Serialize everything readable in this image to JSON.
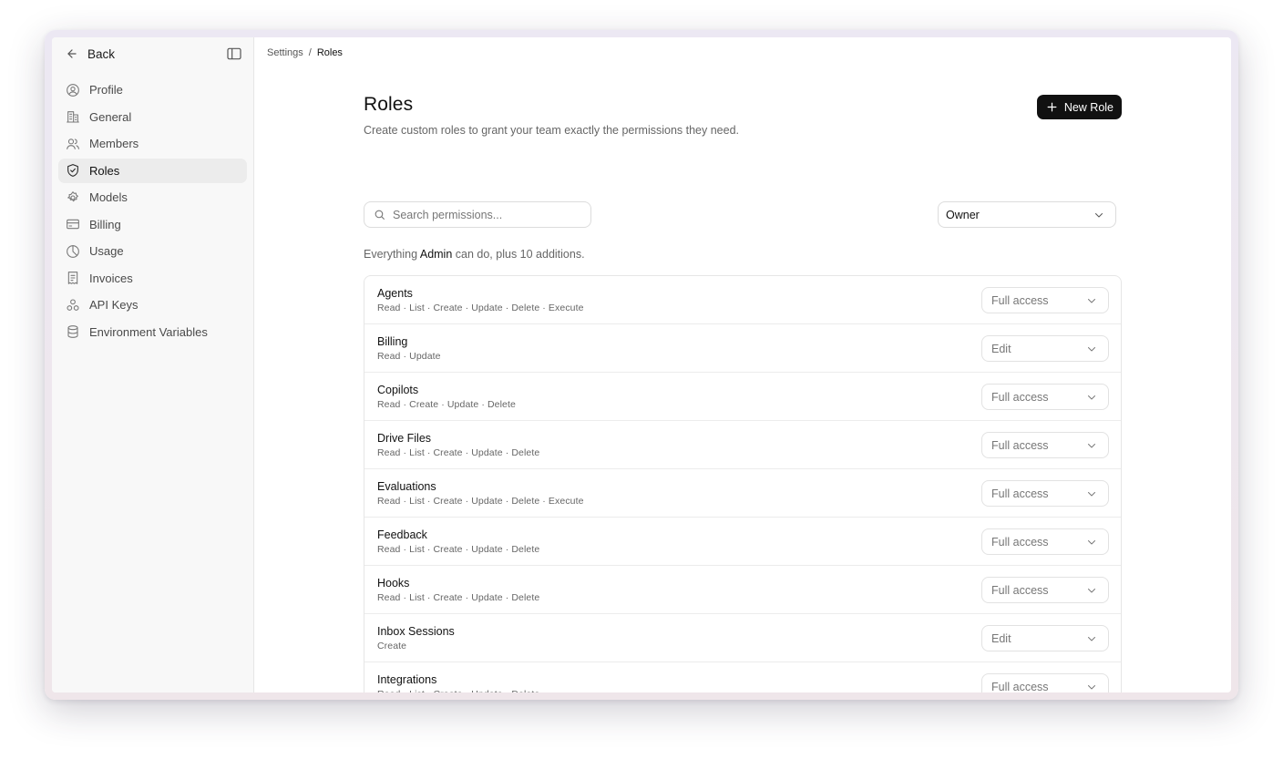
{
  "sidebar": {
    "back_label": "Back",
    "items": [
      {
        "label": "Profile",
        "icon": "user-circle-icon",
        "active": false
      },
      {
        "label": "General",
        "icon": "building-icon",
        "active": false
      },
      {
        "label": "Members",
        "icon": "users-icon",
        "active": false
      },
      {
        "label": "Roles",
        "icon": "shield-check-icon",
        "active": true
      },
      {
        "label": "Models",
        "icon": "cpu-icon",
        "active": false
      },
      {
        "label": "Billing",
        "icon": "credit-card-icon",
        "active": false
      },
      {
        "label": "Usage",
        "icon": "pie-chart-icon",
        "active": false
      },
      {
        "label": "Invoices",
        "icon": "receipt-icon",
        "active": false
      },
      {
        "label": "API Keys",
        "icon": "key-nodes-icon",
        "active": false
      },
      {
        "label": "Environment Variables",
        "icon": "database-icon",
        "active": false
      }
    ]
  },
  "breadcrumb": {
    "parent": "Settings",
    "separator": "/",
    "current": "Roles"
  },
  "header": {
    "title": "Roles",
    "subtitle": "Create custom roles to grant your team exactly the permissions they need.",
    "new_role_label": "New Role"
  },
  "search": {
    "placeholder": "Search permissions..."
  },
  "role_select": {
    "value": "Owner"
  },
  "inherit_note": {
    "prefix": "Everything",
    "role": "Admin",
    "suffix": "can do, plus 10 additions."
  },
  "permissions": [
    {
      "name": "Agents",
      "actions": "Read · List · Create · Update · Delete · Execute",
      "access": "Full access"
    },
    {
      "name": "Billing",
      "actions": "Read · Update",
      "access": "Edit"
    },
    {
      "name": "Copilots",
      "actions": "Read · Create · Update · Delete",
      "access": "Full access"
    },
    {
      "name": "Drive Files",
      "actions": "Read · List · Create · Update · Delete",
      "access": "Full access"
    },
    {
      "name": "Evaluations",
      "actions": "Read · List · Create · Update · Delete · Execute",
      "access": "Full access"
    },
    {
      "name": "Feedback",
      "actions": "Read · List · Create · Update · Delete",
      "access": "Full access"
    },
    {
      "name": "Hooks",
      "actions": "Read · List · Create · Update · Delete",
      "access": "Full access"
    },
    {
      "name": "Inbox Sessions",
      "actions": "Create",
      "access": "Edit"
    },
    {
      "name": "Integrations",
      "actions": "Read · List · Create · Update · Delete",
      "access": "Full access"
    }
  ],
  "colors": {
    "primary_button": "#111111",
    "active_nav_bg": "#ececec",
    "sidebar_bg": "#f8f8f8",
    "border": "#e6e6e6"
  }
}
